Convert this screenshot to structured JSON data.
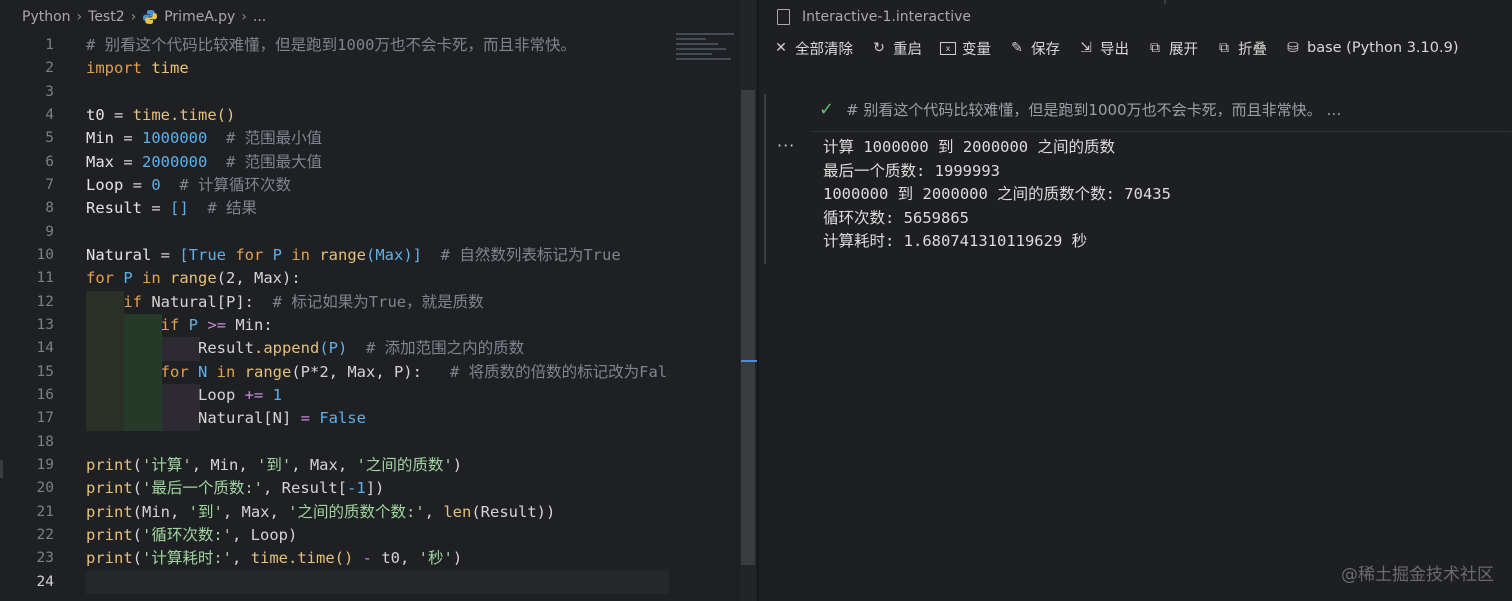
{
  "breadcrumb": {
    "part1": "Python",
    "part2": "Test2",
    "file": "PrimeA.py",
    "tail": "..."
  },
  "editor": {
    "line_numbers": [
      "1",
      "2",
      "3",
      "4",
      "5",
      "6",
      "7",
      "8",
      "9",
      "10",
      "11",
      "12",
      "13",
      "14",
      "15",
      "16",
      "17",
      "18",
      "19",
      "20",
      "21",
      "22",
      "23",
      "24"
    ],
    "active_line": "24"
  },
  "code": {
    "l1": "# 别看这个代码比较难懂，但是跑到1000万也不会卡死，而且非常快。",
    "l2_kw": "import",
    "l2_mod": "time",
    "l4_var": "t0",
    "l4_eq": " = ",
    "l4_mod": "time",
    "l4_fn": ".time()",
    "l5_var": "Min",
    "l5_eq": " = ",
    "l5_num": "1000000",
    "l5_cm": "  # 范围最小值",
    "l6_var": "Max",
    "l6_eq": " = ",
    "l6_num": "2000000",
    "l6_cm": "  # 范围最大值",
    "l7_var": "Loop",
    "l7_eq": " = ",
    "l7_num": "0",
    "l7_cm": "  # 计算循环次数",
    "l8_var": "Result",
    "l8_eq": " = ",
    "l8_br": "[]",
    "l8_cm": "  # 结果",
    "l10_var": "Natural",
    "l10_eq": " = ",
    "l10_a": "[",
    "l10_true": "True",
    "l10_for": " for ",
    "l10_p": "P",
    "l10_in": " in ",
    "l10_range": "range",
    "l10_b": "(Max)]",
    "l10_cm": "  # 自然数列表标记为True",
    "l11_for": "for",
    "l11_p": " P",
    "l11_in": " in ",
    "l11_range": "range",
    "l11_args": "(2, Max):",
    "l12_if": "if",
    "l12_rest": " Natural[P]:",
    "l12_cm": "  # 标记如果为True，就是质数",
    "l13_if": "if",
    "l13_p": " P",
    "l13_op": " >= ",
    "l13_rest": "Min:",
    "l14_obj": "Result",
    "l14_fn": ".append",
    "l14_arg": "(P)",
    "l14_cm": "  # 添加范围之内的质数",
    "l15_for": "for",
    "l15_n": " N",
    "l15_in": " in ",
    "l15_range": "range",
    "l15_args": "(P*2, Max, P):",
    "l15_cm": "   # 将质数的倍数的标记改为False",
    "l16_var": "Loop",
    "l16_op": " += ",
    "l16_num": "1",
    "l17_var": "Natural[N]",
    "l17_op": " = ",
    "l17_false": "False",
    "l19_fn": "print",
    "l19_a": "(",
    "l19_s1": "'计算'",
    "l19_b": ", Min, ",
    "l19_s2": "'到'",
    "l19_c": ", Max, ",
    "l19_s3": "'之间的质数'",
    "l19_d": ")",
    "l20_fn": "print",
    "l20_a": "(",
    "l20_s1": "'最后一个质数:'",
    "l20_b": ", Result[",
    "l20_num": "-1",
    "l20_c": "])",
    "l21_fn": "print",
    "l21_a": "(Min, ",
    "l21_s1": "'到'",
    "l21_b": ", Max, ",
    "l21_s2": "'之间的质数个数:'",
    "l21_c": ", ",
    "l21_len": "len",
    "l21_d": "(Result))",
    "l22_fn": "print",
    "l22_a": "(",
    "l22_s1": "'循环次数:'",
    "l22_b": ", Loop)",
    "l23_fn": "print",
    "l23_a": "(",
    "l23_s1": "'计算耗时:'",
    "l23_b": ", ",
    "l23_mod": "time",
    "l23_c": ".time()",
    "l23_op": " - ",
    "l23_d": "t0, ",
    "l23_s2": "'秒'",
    "l23_e": ")"
  },
  "panel": {
    "tab_title": "Interactive-1.interactive",
    "toolbar": {
      "clear_all": "全部清除",
      "restart": "重启",
      "variables": "变量",
      "save": "保存",
      "export": "导出",
      "expand": "展开",
      "collapse": "折叠",
      "kernel": "base (Python 3.10.9)"
    },
    "cell_input_text": "# 别看这个代码比较难懂，但是跑到1000万也不会卡死，而且非常快。 …",
    "ellipsis": "···",
    "output_lines": [
      "计算 1000000 到 2000000 之间的质数",
      "最后一个质数: 1999993",
      "1000000 到 2000000 之间的质数个数: 70435",
      "循环次数: 5659865",
      "计算耗时: 1.680741310119629 秒"
    ]
  },
  "watermark": "@稀土掘金技术社区"
}
